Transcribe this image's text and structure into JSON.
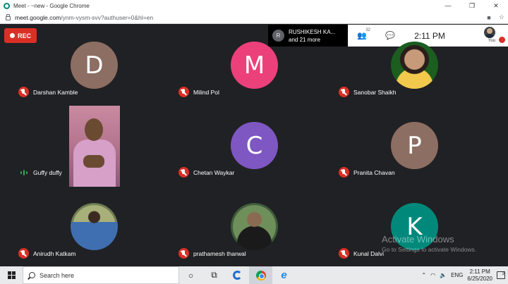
{
  "window": {
    "title": "Meet - ~new - Google Chrome",
    "controls": [
      "—",
      "❐",
      "✕"
    ]
  },
  "address": {
    "host": "meet.google.com",
    "path": "/ynm-vysm-svv?authuser=0&hl=en"
  },
  "meet": {
    "rec_label": "REC",
    "presenter": {
      "initial": "R",
      "name": "RUSHIKESH KA...",
      "more": "and 21 more"
    },
    "participants_count": "32",
    "time": "2:11 PM",
    "self_label": "You",
    "tiles": [
      {
        "name": "Darshan Kamble",
        "initial": "D",
        "color": "#8d6e63",
        "mic": "off"
      },
      {
        "name": "Milind Pol",
        "initial": "M",
        "color": "#ec407a",
        "mic": "off"
      },
      {
        "name": "Sanobar Shaikh",
        "initial": "",
        "color": "#1b5e20",
        "mic": "off"
      },
      {
        "name": "Guffy duffy",
        "initial": "",
        "color": "",
        "mic": "speaking"
      },
      {
        "name": "Chetan Waykar",
        "initial": "C",
        "color": "#7e57c2",
        "mic": "off"
      },
      {
        "name": "Pranita Chavan",
        "initial": "P",
        "color": "#8d6e63",
        "mic": "off"
      },
      {
        "name": "Anirudh Katkam",
        "initial": "",
        "color": "#6d7a52",
        "mic": "off"
      },
      {
        "name": "prathamesh tharwal",
        "initial": "",
        "color": "#3f5a3a",
        "mic": "off"
      },
      {
        "name": "Kunal Dalvi",
        "initial": "K",
        "color": "#00897b",
        "mic": "off"
      }
    ]
  },
  "watermark": {
    "line1": "Activate Windows",
    "line2": "Go to Settings to activate Windows."
  },
  "taskbar": {
    "search_placeholder": "Search here",
    "tray_lang": "ENG",
    "clock_time": "2:11 PM",
    "clock_date": "6/25/2020",
    "notifications": "3"
  }
}
